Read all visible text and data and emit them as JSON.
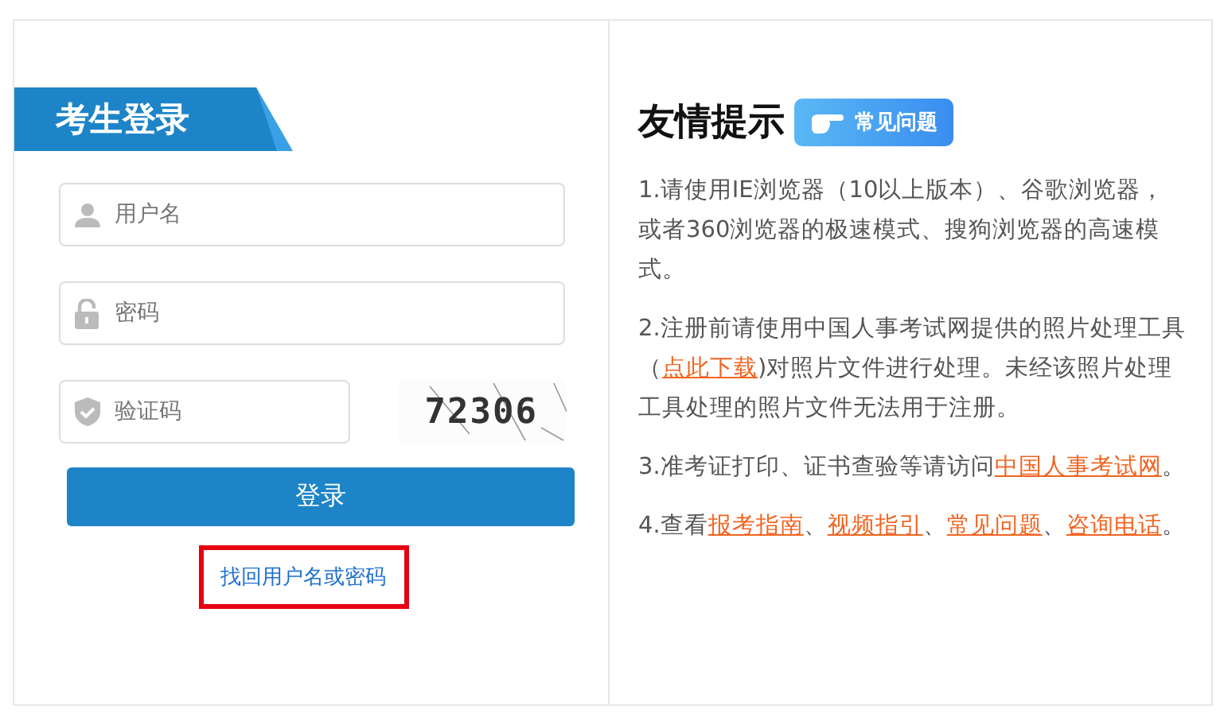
{
  "login": {
    "title": "考生登录",
    "fields": [
      {
        "kind": "user",
        "placeholder": "用户名"
      },
      {
        "kind": "password",
        "placeholder": "密码"
      },
      {
        "kind": "captcha",
        "placeholder": "验证码"
      }
    ],
    "captcha_text": "72306",
    "submit": "登录",
    "forgot_link": "找回用户名或密码"
  },
  "tips": {
    "title": "友情提示",
    "badge": "常见问题",
    "paragraphs": [
      [
        {
          "text": "1.请使用IE浏览器（10以上版本）、谷歌浏览器，或者360浏览器的极速模式、搜狗浏览器的高速模式。",
          "link": false
        }
      ],
      [
        {
          "text": "2.注册前请使用中国人事考试网提供的照片处理工具（",
          "link": false
        },
        {
          "text": "点此下载",
          "link": true
        },
        {
          "text": ")对照片文件进行处理。未经该照片处理工具处理的照片文件无法用于注册。",
          "link": false
        }
      ],
      [
        {
          "text": "3.准考证打印、证书查验等请访问",
          "link": false
        },
        {
          "text": "中国人事考试网",
          "link": true
        },
        {
          "text": "。",
          "link": false
        }
      ],
      [
        {
          "text": "4.查看",
          "link": false
        },
        {
          "text": "报考指南",
          "link": true
        },
        {
          "text": "、",
          "link": false
        },
        {
          "text": "视频指引",
          "link": true
        },
        {
          "text": "、",
          "link": false
        },
        {
          "text": "常见问题",
          "link": true
        },
        {
          "text": "、",
          "link": false
        },
        {
          "text": "咨询电话",
          "link": true
        },
        {
          "text": "。",
          "link": false
        }
      ]
    ]
  }
}
